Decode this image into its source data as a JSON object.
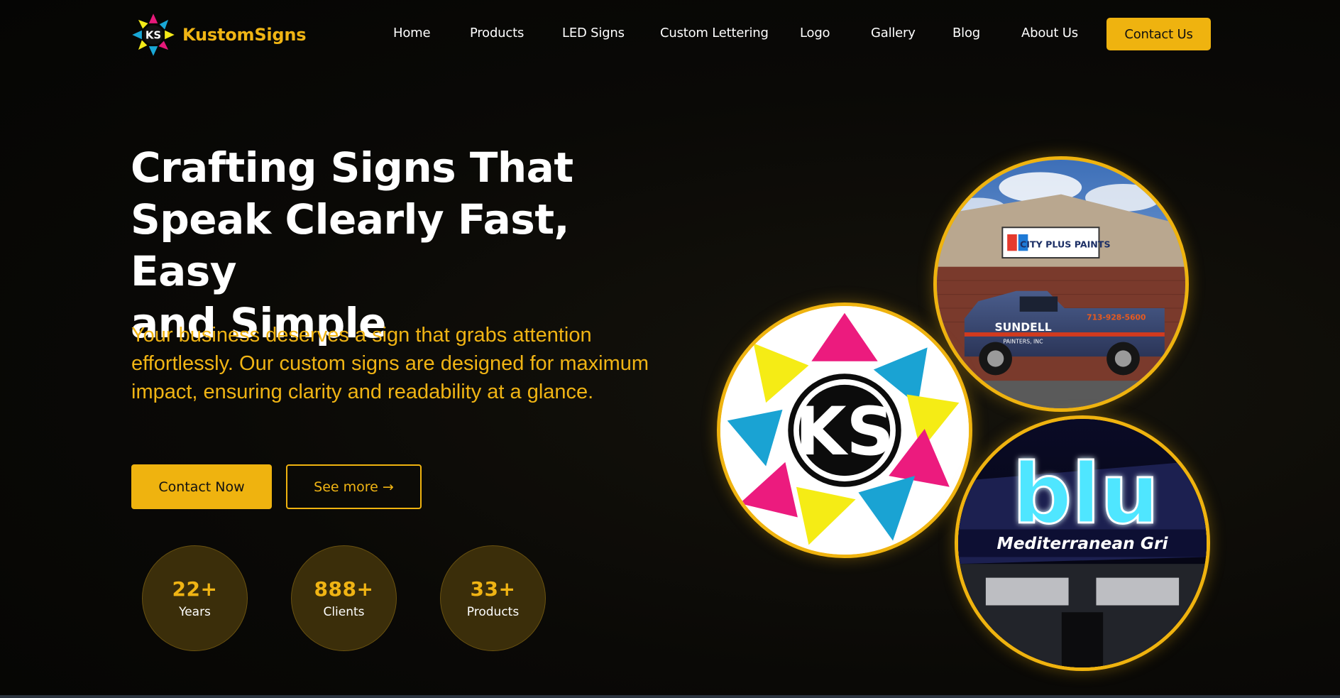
{
  "brand": {
    "name": "KustomSigns",
    "logo_icon": "ks-star-logo-icon"
  },
  "nav": {
    "items": [
      {
        "label": "Home"
      },
      {
        "label": "Products"
      },
      {
        "label": "LED Signs"
      },
      {
        "label": "Custom Lettering"
      },
      {
        "label": "Logo"
      },
      {
        "label": "Gallery"
      },
      {
        "label": "Blog"
      },
      {
        "label": "About Us"
      }
    ],
    "cta_label": "Contact Us"
  },
  "hero": {
    "title_lines": [
      "Crafting Signs That",
      "Speak Clearly Fast, Easy",
      "and Simple"
    ],
    "subtitle": "Your business deserves a sign that grabs attention effortlessly. Our custom signs are designed for maximum impact, ensuring clarity and readability at a glance.",
    "primary_button": "Contact Now",
    "secondary_button": "See more →"
  },
  "stats": [
    {
      "value": "22+",
      "label": "Years"
    },
    {
      "value": "888+",
      "label": "Clients"
    },
    {
      "value": "33+",
      "label": "Products"
    }
  ],
  "gallery": {
    "truck_image": {
      "store_sign": "CITY PLUS PAINTS",
      "truck_brand": "SUNDELL",
      "truck_sub": "PAINTERS, INC",
      "truck_phone": "713-928-5600"
    },
    "sign_image": {
      "big_text": "blu",
      "sub_text": "Mediterranean Gri"
    },
    "logo_image": {
      "letters": "KS"
    }
  },
  "colors": {
    "accent": "#efb30f",
    "background": "#070706",
    "text": "#ffffff"
  }
}
